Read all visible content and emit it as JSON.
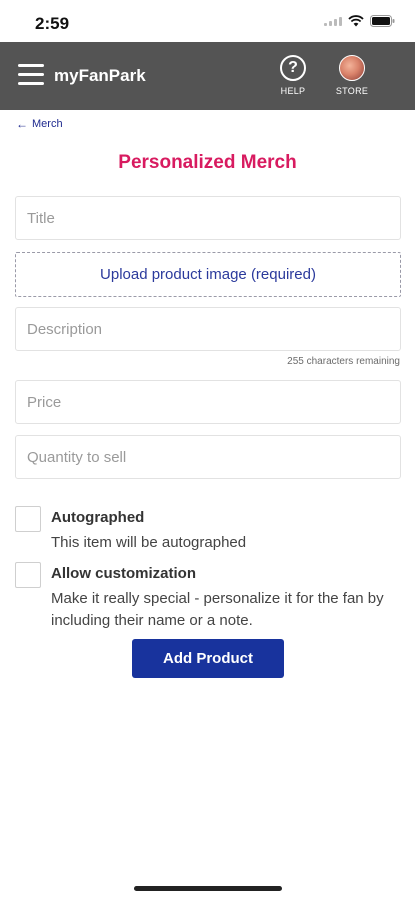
{
  "status_bar": {
    "time": "2:59"
  },
  "header": {
    "app_title": "myFanPark",
    "help_label": "HELP",
    "help_glyph": "?",
    "store_label": "STORE",
    "background": "#545454"
  },
  "breadcrumb": {
    "label": "Merch"
  },
  "page": {
    "title": "Personalized Merch",
    "title_color": "#d81b60"
  },
  "form": {
    "title_placeholder": "Title",
    "upload_label": "Upload product image (required)",
    "description_placeholder": "Description",
    "char_count": "255 characters remaining",
    "price_placeholder": "Price",
    "quantity_placeholder": "Quantity to sell"
  },
  "options": {
    "autographed": {
      "label": "Autographed",
      "description": "This item will be autographed",
      "checked": false
    },
    "customization": {
      "label": "Allow customization",
      "description": "Make it really special - personalize it for the fan by including their name or a note.",
      "checked": false
    }
  },
  "actions": {
    "add_product": "Add Product",
    "accent": "#18339d"
  }
}
